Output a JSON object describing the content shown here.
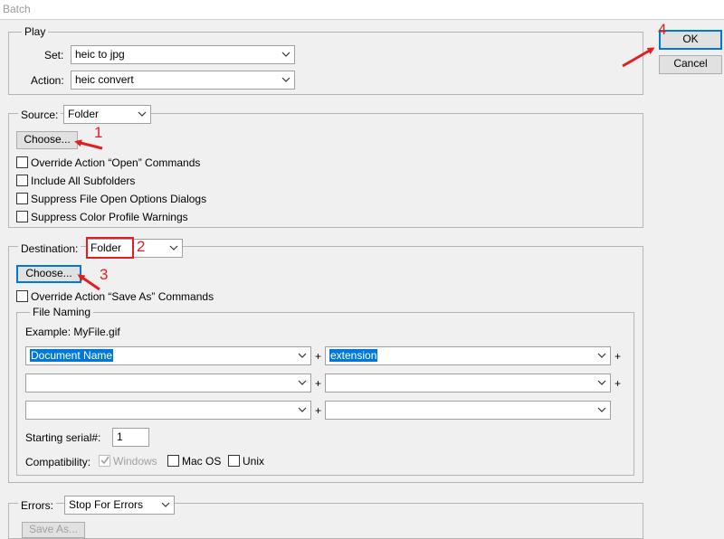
{
  "window": {
    "title": "Batch"
  },
  "buttons": {
    "ok": "OK",
    "cancel": "Cancel"
  },
  "play": {
    "legend": "Play",
    "set_label": "Set:",
    "set_value": "heic to jpg",
    "action_label": "Action:",
    "action_value": "heic convert"
  },
  "source": {
    "label": "Source:",
    "value": "Folder",
    "choose": "Choose...",
    "options": [
      "Override Action “Open” Commands",
      "Include All Subfolders",
      "Suppress File Open Options Dialogs",
      "Suppress Color Profile Warnings"
    ]
  },
  "destination": {
    "label": "Destination:",
    "value": "Folder",
    "choose": "Choose...",
    "override": "Override Action “Save As” Commands"
  },
  "file_naming": {
    "legend": "File Naming",
    "example": "Example: MyFile.gif",
    "row1": {
      "a": "Document Name",
      "b": "extension"
    },
    "plus": "+",
    "serial_label": "Starting serial#:",
    "serial_value": "1",
    "compat_label": "Compatibility:",
    "compat_windows": "Windows",
    "compat_mac": "Mac OS",
    "compat_unix": "Unix"
  },
  "errors": {
    "label": "Errors:",
    "value": "Stop For Errors",
    "save_as": "Save As..."
  },
  "annotations": {
    "n1": "1",
    "n2": "2",
    "n3": "3",
    "n4": "4",
    "color": "#e02020"
  }
}
